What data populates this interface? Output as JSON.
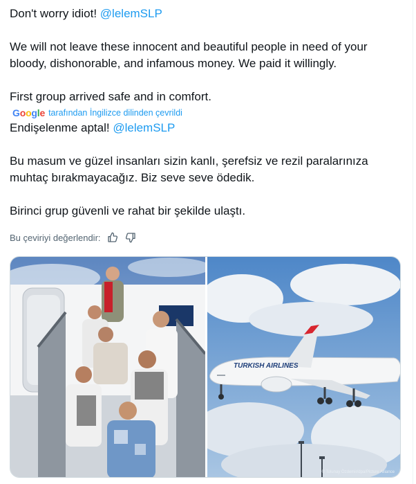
{
  "tweet": {
    "original": {
      "line1_prefix": "Don't worry idiot! ",
      "line1_mention": "@lelemSLP",
      "para2": "We will not leave these innocent and beautiful people in need of your bloody, dishonorable, and infamous money. We paid it willingly.",
      "para3": "First group arrived safe and in comfort."
    },
    "translation_bar": {
      "google_letters": [
        "G",
        "o",
        "o",
        "g",
        "l",
        "e"
      ],
      "google_colors": [
        "#4285f4",
        "#ea4335",
        "#fbbc05",
        "#4285f4",
        "#34a853",
        "#ea4335"
      ],
      "text": "tarafından İngilizce dilinden çevrildi"
    },
    "translated": {
      "line1_prefix": "Endişelenme aptal! ",
      "line1_mention": "@lelemSLP",
      "para2": "Bu masum ve güzel insanları sizin kanlı, şerefsiz ve rezil paralarınıza muhtaç bırakmayacağız. Biz seve seve ödedik.",
      "para3": "Birinci grup güvenli ve rahat bir şekilde ulaştı."
    },
    "rate": {
      "label": "Bu çeviriyi değerlendir:",
      "thumbs_up_icon": "thumbs-up-icon",
      "thumbs_down_icon": "thumbs-down-icon"
    }
  },
  "media": {
    "photo1": "people-descending-airplane-stairs-photo",
    "photo2": "turkish-airlines-plane-in-flight-photo",
    "plane_livery": "TURKISH AIRLINES",
    "credit": "© Tolunay Özdemir/dpa/Picture Alliance"
  },
  "colors": {
    "link": "#1d9bf0",
    "text": "#0f1419",
    "muted": "#536471"
  }
}
